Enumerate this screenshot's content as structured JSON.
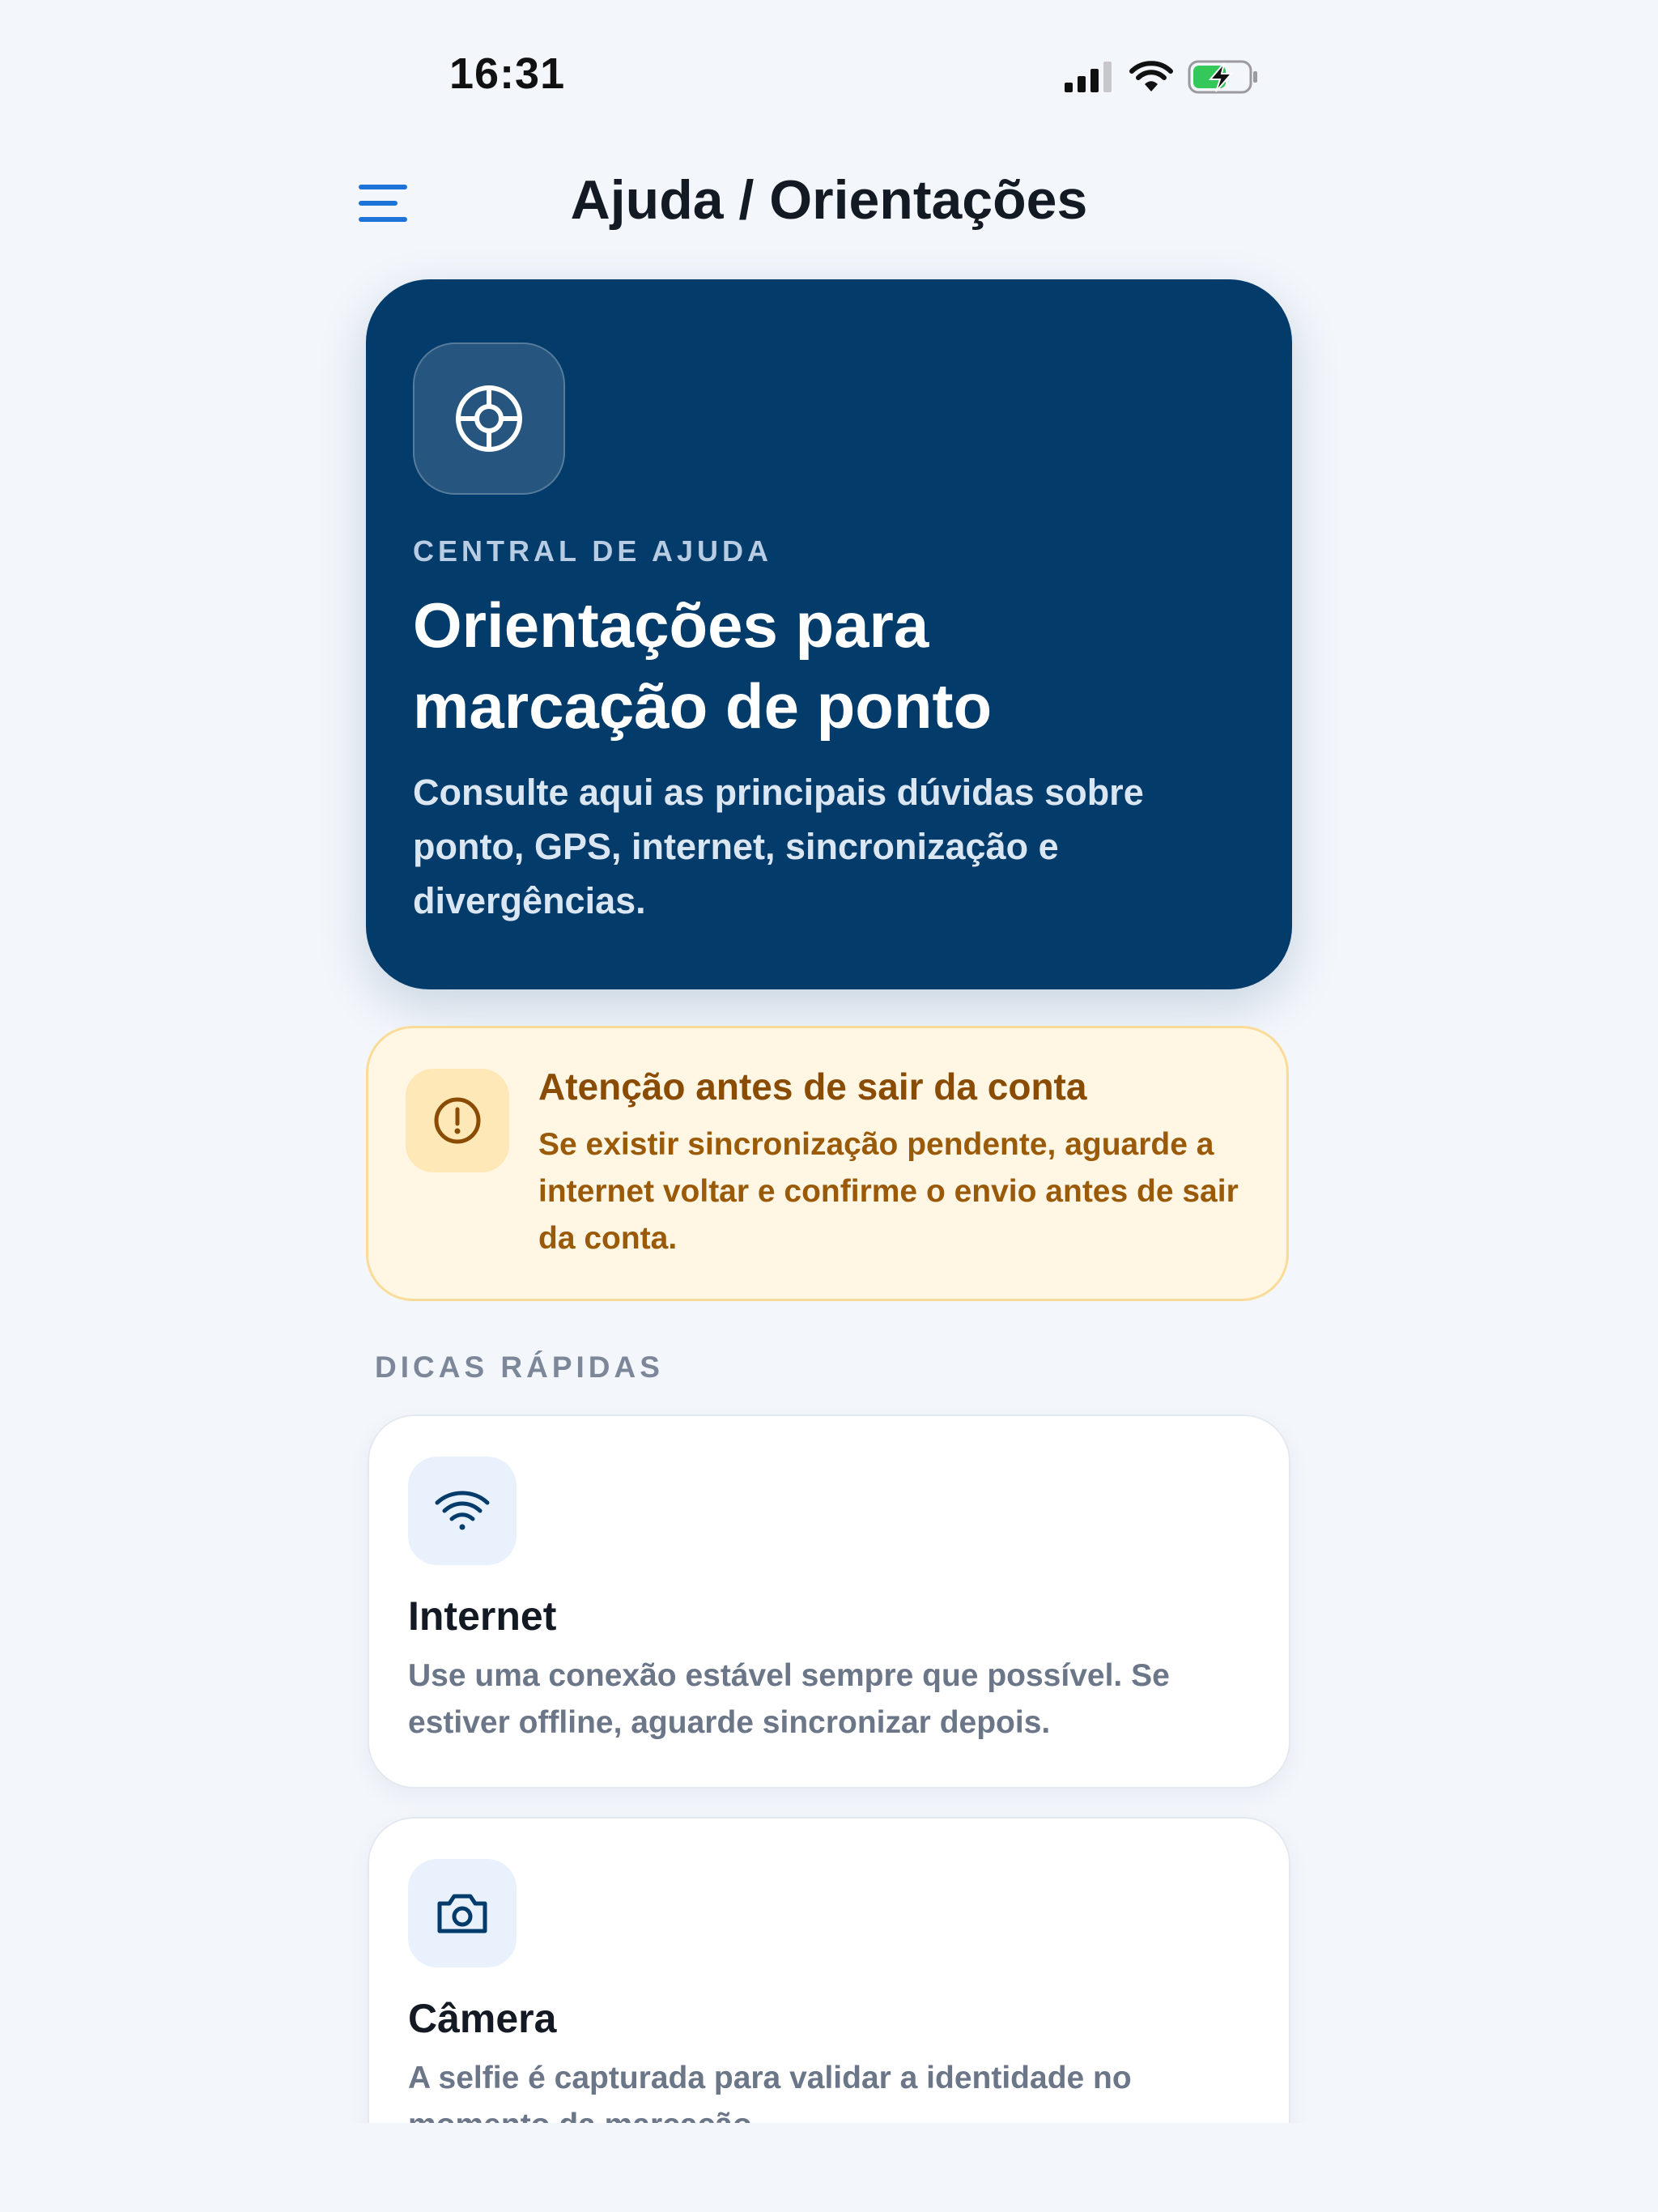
{
  "status_bar": {
    "time": "16:31"
  },
  "header": {
    "title": "Ajuda / Orientações"
  },
  "hero": {
    "kicker": "CENTRAL DE AJUDA",
    "title": "Orientações para marcação de ponto",
    "description": "Consulte aqui as principais dúvidas sobre ponto, GPS, internet, sincronização e divergências.",
    "icon": "lifebuoy-icon"
  },
  "alert": {
    "title": "Atenção antes de sair da conta",
    "text": "Se existir sincronização pendente, aguarde a internet voltar e confirme o envio antes de sair da conta.",
    "icon": "warning-icon"
  },
  "quick_tips": {
    "section_title": "DICAS RÁPIDAS",
    "items": [
      {
        "title": "Internet",
        "text": "Use uma conexão estável sempre que possível. Se estiver offline, aguarde sincronizar depois.",
        "icon": "wifi-icon"
      },
      {
        "title": "Câmera",
        "text": "A selfie é capturada para validar a identidade no momento da marcação.",
        "icon": "camera-icon"
      }
    ]
  },
  "colors": {
    "accent": "#1e73d8",
    "hero_bg": "#033b6b",
    "alert_bg": "#fff6e4",
    "alert_text": "#8a4b03",
    "battery_green": "#34c759"
  }
}
